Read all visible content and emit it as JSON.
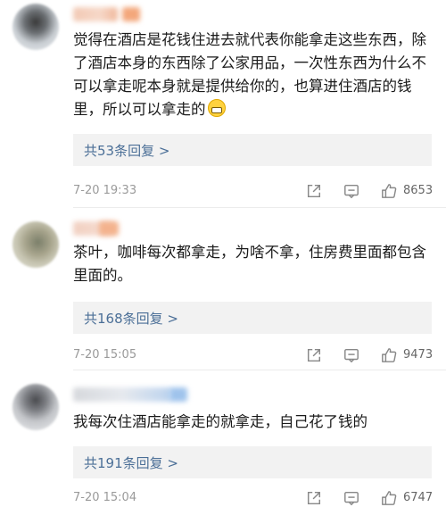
{
  "comments": [
    {
      "text": "觉得在酒店是花钱住进去就代表你能拿走这些东西，除了酒店本身的东西除了公家用品，一次性东西为什么不可以拿走呢本身就是提供给你的，也算进住酒店的钱里，所以可以拿走的",
      "reply_link": "共53条回复 >",
      "time": "7-20 19:33",
      "likes": "8653"
    },
    {
      "text": "茶叶，咖啡每次都拿走，为啥不拿，住房费里面都包含里面的。",
      "reply_link": "共168条回复 >",
      "time": "7-20 15:05",
      "likes": "9473"
    },
    {
      "text": "我每次住酒店能拿走的就拿走，自己花了钱的",
      "reply_link": "共191条回复 >",
      "time": "7-20 15:04",
      "likes": "6747"
    }
  ],
  "icons": {
    "share": "share-icon",
    "comment": "comment-icon",
    "like": "like-icon",
    "emoji": "grin-emoji-icon"
  },
  "colors": {
    "link": "#4b6f97",
    "reply_bg": "#f2f2f2",
    "meta": "#9a9a9a"
  }
}
